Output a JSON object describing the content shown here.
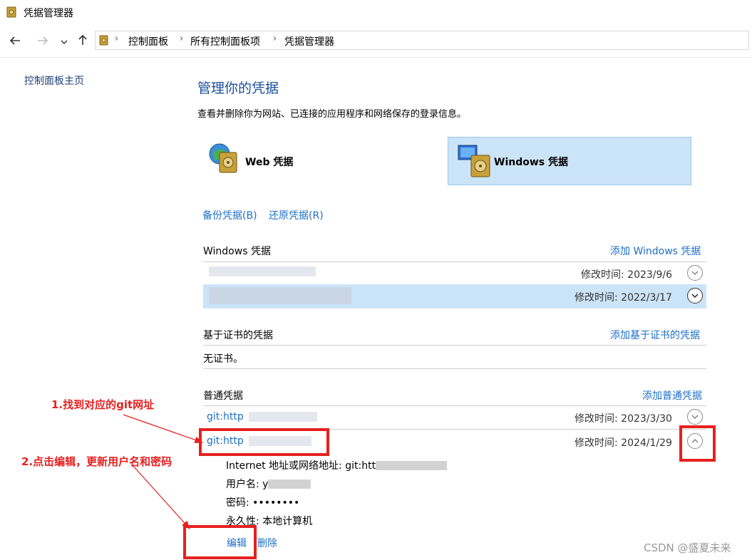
{
  "window": {
    "title": "凭据管理器"
  },
  "nav": {
    "breadcrumb": [
      "控制面板",
      "所有控制面板项",
      "凭据管理器"
    ]
  },
  "sidebar": {
    "home_link": "控制面板主页"
  },
  "main": {
    "title": "管理你的凭据",
    "description": "查看并删除你为网站、已连接的应用程序和网络保存的登录信息。",
    "tiles": [
      {
        "label": "Web 凭据",
        "selected": false,
        "icon": "web-credentials-icon"
      },
      {
        "label": "Windows 凭据",
        "selected": true,
        "icon": "windows-credentials-icon"
      }
    ],
    "backup_link": "备份凭据(B)",
    "restore_link": "还原凭据(R)"
  },
  "windows_creds": {
    "header": "Windows 凭据",
    "add_link": "添加 Windows 凭据",
    "rows": [
      {
        "modified": "修改时间:  2023/9/6"
      },
      {
        "modified": "修改时间:  2022/3/17"
      }
    ]
  },
  "cert_creds": {
    "header": "基于证书的凭据",
    "add_link": "添加基于证书的凭据",
    "empty": "无证书。"
  },
  "generic_creds": {
    "header": "普通凭据",
    "add_link": "添加普通凭据",
    "rows": [
      {
        "name": "git:http",
        "modified": "修改时间:  2023/3/30"
      },
      {
        "name": "git:http",
        "modified": "修改时间:  2024/1/29"
      }
    ],
    "details": {
      "address_label": "Internet 地址或网络地址:",
      "address_value": "git:htt",
      "username_label": "用户名:",
      "username_value": "y",
      "password_label": "密码:",
      "password_value": "••••••••",
      "persistence_label": "永久性:",
      "persistence_value": "本地计算机"
    },
    "edit_link": "编辑",
    "delete_link": "删除"
  },
  "annotations": {
    "step1": "1.找到对应的git网址",
    "step2": "2.点击编辑，更新用户名和密码",
    "color": "#e62020"
  },
  "watermark": "CSDN @盛夏未来"
}
